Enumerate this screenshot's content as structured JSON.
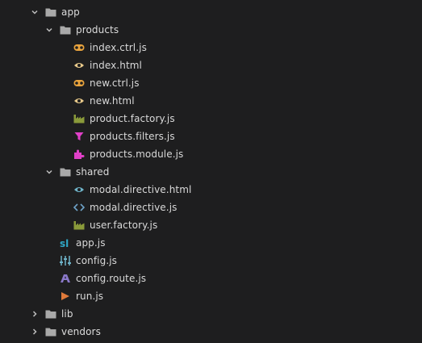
{
  "colors": {
    "background": "#1e1e1f",
    "text": "#d9d9d9",
    "folder": "#a9a9a9",
    "angular": "#e8a33d",
    "html": "#e8c98a",
    "factory": "#8a9a3a",
    "filter": "#e040c8",
    "module": "#e040c8",
    "eye_teal": "#6fb3c9",
    "code": "#6fa3c9",
    "appjs": "#2fa8c7",
    "config": "#6fb3c9",
    "route": "#8a78c9",
    "run": "#e07a3a"
  },
  "tree": {
    "app": {
      "label": "app",
      "expanded": true,
      "icon": "folder-icon"
    },
    "products": {
      "label": "products",
      "expanded": true,
      "icon": "folder-icon"
    },
    "products_files": [
      {
        "label": "index.ctrl.js",
        "icon": "angular-controller-icon"
      },
      {
        "label": "index.html",
        "icon": "eye-icon"
      },
      {
        "label": "new.ctrl.js",
        "icon": "angular-controller-icon"
      },
      {
        "label": "new.html",
        "icon": "eye-icon"
      },
      {
        "label": "product.factory.js",
        "icon": "factory-icon"
      },
      {
        "label": "products.filters.js",
        "icon": "filter-icon"
      },
      {
        "label": "products.module.js",
        "icon": "module-icon"
      }
    ],
    "shared": {
      "label": "shared",
      "expanded": true,
      "icon": "folder-icon"
    },
    "shared_files": [
      {
        "label": "modal.directive.html",
        "icon": "eye-icon"
      },
      {
        "label": "modal.directive.js",
        "icon": "code-icon"
      },
      {
        "label": "user.factory.js",
        "icon": "factory-icon"
      }
    ],
    "app_files": [
      {
        "label": "app.js",
        "icon": "app-js-icon"
      },
      {
        "label": "config.js",
        "icon": "config-icon"
      },
      {
        "label": "config.route.js",
        "icon": "route-icon"
      },
      {
        "label": "run.js",
        "icon": "run-icon"
      }
    ],
    "lib": {
      "label": "lib",
      "expanded": false,
      "icon": "folder-icon"
    },
    "vendors": {
      "label": "vendors",
      "expanded": false,
      "icon": "folder-icon"
    }
  }
}
